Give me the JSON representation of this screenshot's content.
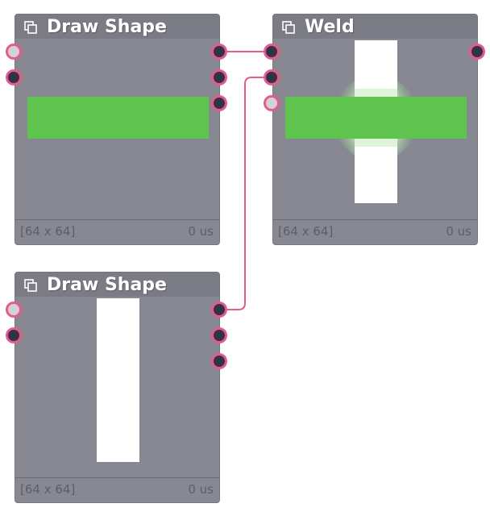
{
  "nodes": {
    "draw_shape_1": {
      "title": "Draw Shape",
      "size": "[64 x 64]",
      "time": "0 us"
    },
    "weld": {
      "title": "Weld",
      "size": "[64 x 64]",
      "time": "0 us"
    },
    "draw_shape_2": {
      "title": "Draw Shape",
      "size": "[64 x 64]",
      "time": "0 us"
    }
  },
  "colors": {
    "node_body": "#888893",
    "node_header": "#7b7b86",
    "wire": "#e85a88",
    "port_fill": "#333347",
    "shape_green": "#5fc44d",
    "shape_white": "#ffffff"
  },
  "icons": {
    "node_icon": "copy-layers-icon"
  }
}
